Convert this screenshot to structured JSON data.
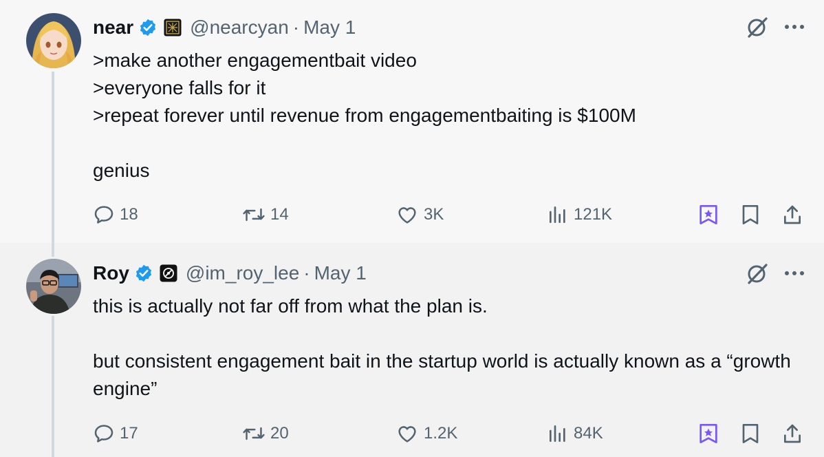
{
  "tweets": [
    {
      "author": {
        "name": "near",
        "handle": "@nearcyan",
        "date": "May 1",
        "separator": "·",
        "verified_icon": "verified-badge-icon",
        "affiliation_icon": "affiliation-badge-icon"
      },
      "lines": [
        ">make another engagementbait video",
        ">everyone falls for it",
        ">repeat forever until revenue from engagementbaiting is $100M",
        "",
        "genius"
      ],
      "stats": {
        "replies": "18",
        "retweets": "14",
        "likes": "3K",
        "views": "121K"
      }
    },
    {
      "author": {
        "name": "Roy",
        "handle": "@im_roy_lee",
        "date": "May 1",
        "separator": "·",
        "verified_icon": "verified-badge-icon",
        "affiliation_icon": "affiliation-badge-icon"
      },
      "lines": [
        "this is actually not far off from what the plan is.",
        "",
        "but consistent engagement bait in the startup world is actually known as a “growth engine”"
      ],
      "stats": {
        "replies": "17",
        "retweets": "20",
        "likes": "1.2K",
        "views": "84K"
      }
    }
  ],
  "colors": {
    "text": "#0f1419",
    "secondary": "#536471",
    "verified": "#1d9bf0",
    "grok": "#7856ff",
    "thread_line": "#cfd9de"
  }
}
